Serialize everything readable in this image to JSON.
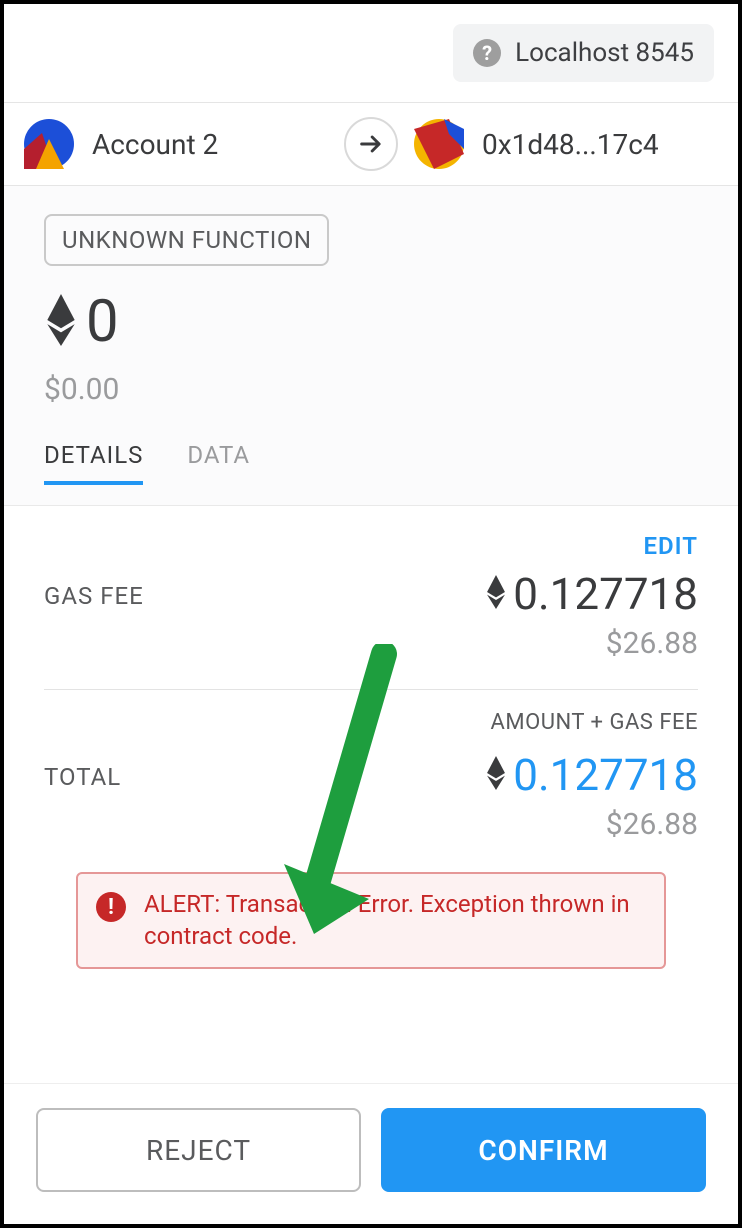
{
  "header": {
    "network_label": "Localhost 8545"
  },
  "accounts": {
    "from_name": "Account 2",
    "to_address": "0x1d48...17c4"
  },
  "summary": {
    "function_label": "UNKNOWN FUNCTION",
    "amount_eth": "0",
    "amount_usd": "$0.00"
  },
  "tabs": {
    "details": "DETAILS",
    "data": "DATA"
  },
  "details": {
    "edit_label": "EDIT",
    "gas_fee_label": "GAS FEE",
    "gas_fee_eth": "0.127718",
    "gas_fee_usd": "$26.88",
    "total_label": "TOTAL",
    "total_sub_label": "AMOUNT + GAS FEE",
    "total_eth": "0.127718",
    "total_usd": "$26.88"
  },
  "alert": {
    "text": "ALERT: Transaction Error. Exception thrown in contract code."
  },
  "footer": {
    "reject": "REJECT",
    "confirm": "CONFIRM"
  }
}
